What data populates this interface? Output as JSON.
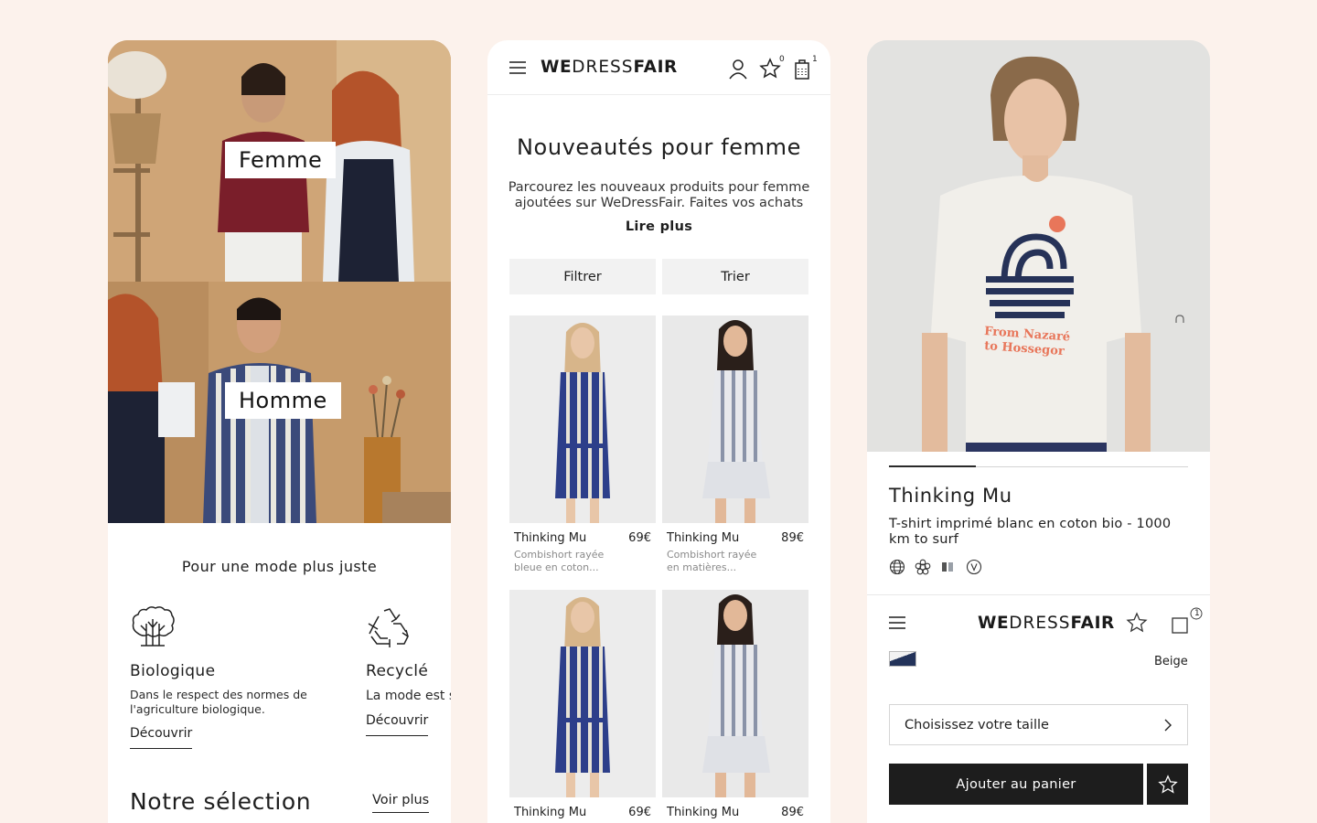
{
  "colors": {
    "page_background": "#fcf2ec",
    "card_background": "#ffffff",
    "button_dark": "#1d1d1d",
    "button_grey": "#f2f2f2"
  },
  "screen_home": {
    "hero_women_label": "Femme",
    "hero_men_label": "Homme",
    "tagline": "Pour une mode plus juste",
    "features": [
      {
        "icon": "organic-tree-icon",
        "title": "Biologique",
        "description": "Dans le respect des normes de l'agriculture biologique.",
        "link": "Découvrir"
      },
      {
        "icon": "recycle-icon",
        "title": "Recyclé",
        "description": "La mode est  sélection.",
        "link": "Découvrir"
      }
    ],
    "selection_title": "Notre sélection",
    "selection_link": "Voir plus"
  },
  "screen_category": {
    "header": {
      "logo_we": "WE",
      "logo_dress": "DRESS",
      "logo_fair": "FAIR",
      "wishlist_count": "0",
      "cart_count": "1"
    },
    "title": "Nouveautés pour femme",
    "description": "Parcourez les nouveaux produits pour femme ajoutées sur WeDressFair. Faites vos achats",
    "read_more": "Lire plus",
    "filter_label": "Filtrer",
    "sort_label": "Trier",
    "products": [
      {
        "brand": "Thinking Mu",
        "price": "69€",
        "description": "Combishort rayée bleue en coton..."
      },
      {
        "brand": "Thinking Mu",
        "price": "89€",
        "description": "Combishort rayée en matières..."
      },
      {
        "brand": "Thinking Mu",
        "price": "69€",
        "description": ""
      },
      {
        "brand": "Thinking Mu",
        "price": "89€",
        "description": ""
      }
    ]
  },
  "screen_product": {
    "gallery_progress": 0.29,
    "brand": "Thinking Mu",
    "description": "T-shirt imprimé blanc en coton bio - 1000 km to surf",
    "badges": [
      "globe-icon",
      "cotton-icon",
      "color-swatch-icon",
      "vegan-icon"
    ],
    "header": {
      "logo_we": "WE",
      "logo_dress": "DRESS",
      "logo_fair": "FAIR",
      "cart_count": "1"
    },
    "color_name": "Beige",
    "size_placeholder": "Choisissez votre taille",
    "add_to_cart": "Ajouter au panier"
  }
}
